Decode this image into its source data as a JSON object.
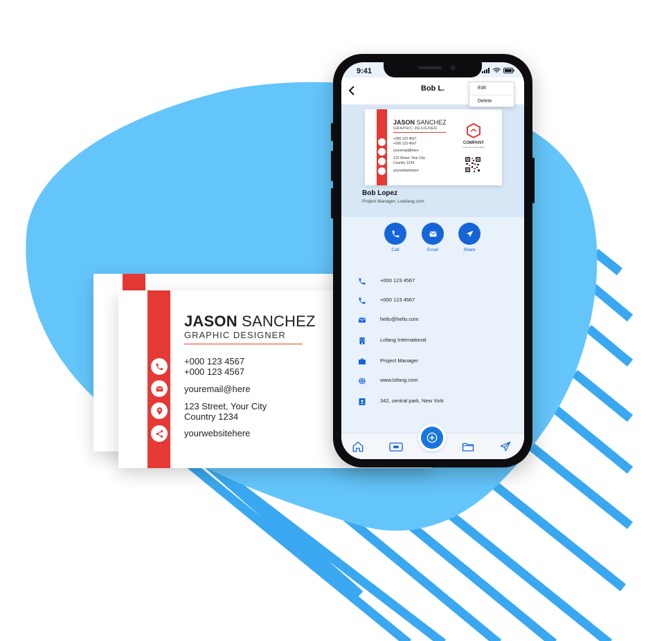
{
  "colors": {
    "blob": "#64c5fb",
    "stripes": "#3aa8f0",
    "card_red": "#e53935",
    "app_blue": "#1565d8"
  },
  "physical_card": {
    "first_name": "JASON",
    "last_name": " SANCHEZ",
    "title": "GRAPHIC  DESIGNER",
    "phone_1": "+000 123 4567",
    "phone_2": "+000 123 4567",
    "email": "youremail@here",
    "address_1": "123 Street, Your City",
    "address_2": "Country 1234",
    "website": "yourwebsitehere",
    "icons": [
      "phone-icon",
      "mail-icon",
      "location-icon",
      "share-icon"
    ]
  },
  "phone": {
    "status_time": "9:41",
    "header_title": "Bob L.",
    "menu_items": [
      "Edit",
      "Delete"
    ],
    "preview_card": {
      "first_name": "JASON",
      "last_name": " SANCHEZ",
      "title": "GRAPHIC  DESIGNER",
      "phone_1": "+000 123 4567",
      "phone_2": "+000 123 4567",
      "email": "youremail@here",
      "address_1": "123 Street, Your City",
      "address_2": "Country 1234",
      "website": "yourwebsitehere",
      "company": "COMPANY",
      "tagline": "TAGLINE GOES HERE"
    },
    "contact_name": "Bob Lopez",
    "contact_subtitle": "Project Manager,  Lowfang.com",
    "actions": [
      {
        "label": "Call",
        "icon": "phone-icon"
      },
      {
        "label": "Email",
        "icon": "mail-icon"
      },
      {
        "label": "Share",
        "icon": "send-icon"
      }
    ],
    "details": [
      {
        "icon": "phone-icon",
        "text": "+000 123 4567"
      },
      {
        "icon": "phone-icon",
        "text": "+000 123 4567"
      },
      {
        "icon": "mail-icon",
        "text": "hello@hello.com"
      },
      {
        "icon": "building-icon",
        "text": "Lofang International"
      },
      {
        "icon": "briefcase-icon",
        "text": "Project Manager"
      },
      {
        "icon": "globe-icon",
        "text": "www.lofang.com"
      },
      {
        "icon": "contact-card-icon",
        "text": "342, central park, New York"
      }
    ],
    "bottom_nav": [
      "home-icon",
      "card-icon",
      "scan-icon",
      "folder-icon",
      "send-icon"
    ]
  }
}
